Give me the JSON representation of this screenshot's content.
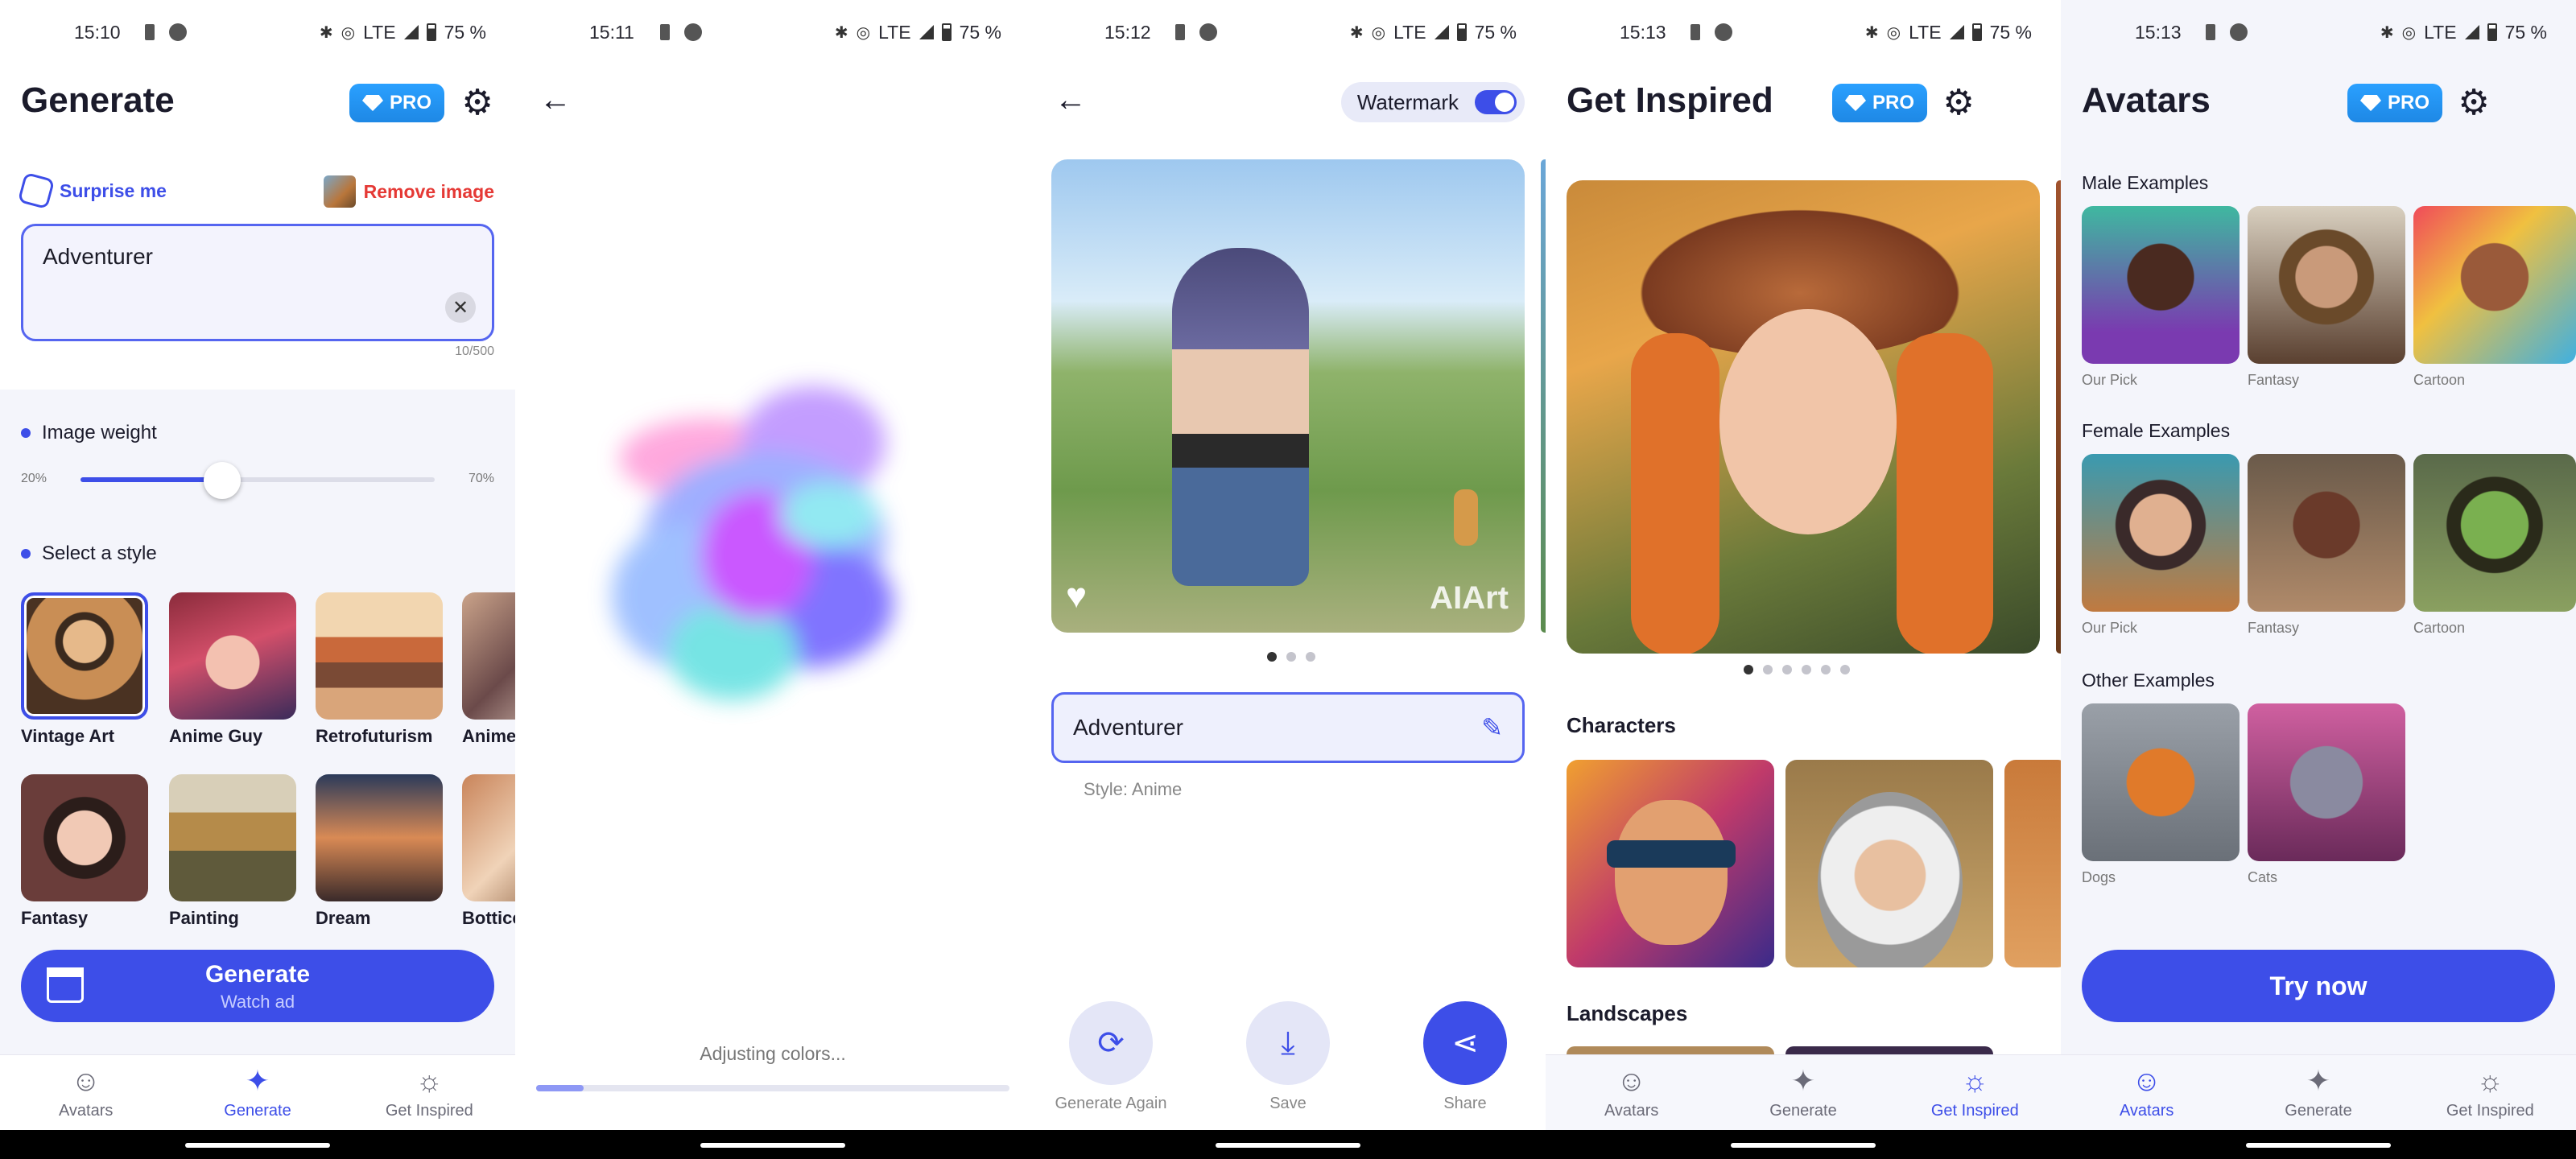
{
  "status": [
    {
      "time": "15:10",
      "network": "LTE",
      "battery": "75 %"
    },
    {
      "time": "15:11",
      "network": "LTE",
      "battery": "75 %"
    },
    {
      "time": "15:12",
      "network": "LTE",
      "battery": "75 %"
    },
    {
      "time": "15:13",
      "network": "LTE",
      "battery": "75 %"
    },
    {
      "time": "15:13",
      "network": "LTE",
      "battery": "75 %"
    }
  ],
  "nav": {
    "avatars": "Avatars",
    "generate": "Generate",
    "inspired": "Get Inspired"
  },
  "pro_label": "PRO",
  "generate": {
    "title": "Generate",
    "surprise": "Surprise me",
    "remove_image": "Remove image",
    "prompt_value": "Adventurer",
    "counter": "10/500",
    "image_weight_label": "Image weight",
    "weight_min": "20%",
    "weight_max": "70%",
    "weight_value": 0.4,
    "select_style_label": "Select a style",
    "styles": [
      {
        "label": "Vintage Art",
        "selected": true
      },
      {
        "label": "Anime Guy"
      },
      {
        "label": "Retrofuturism"
      },
      {
        "label": "Anime"
      },
      {
        "label": "Fantasy"
      },
      {
        "label": "Painting"
      },
      {
        "label": "Dream"
      },
      {
        "label": "Botticelli"
      }
    ],
    "button_title": "Generate",
    "button_sub": "Watch ad"
  },
  "progress_screen": {
    "status": "Adjusting colors...",
    "progress": 0.1
  },
  "result": {
    "watermark_label": "Watermark",
    "watermark_on": true,
    "watermark_text": "AIArt",
    "prompt": "Adventurer",
    "style_note": "Style: Anime",
    "actions": {
      "again": "Generate Again",
      "save": "Save",
      "share": "Share"
    }
  },
  "inspired": {
    "title": "Get Inspired",
    "characters": "Characters",
    "landscapes": "Landscapes"
  },
  "avatars": {
    "title": "Avatars",
    "male": "Male Examples",
    "female": "Female Examples",
    "other": "Other Examples",
    "male_items": [
      "Our Pick",
      "Fantasy",
      "Cartoon"
    ],
    "female_items": [
      "Our Pick",
      "Fantasy",
      "Cartoon"
    ],
    "other_items": [
      "Dogs",
      "Cats"
    ],
    "try_now": "Try now"
  },
  "colors": {
    "accent": "#3d4ee8",
    "pro": "#1e88e5",
    "danger": "#e53935"
  }
}
